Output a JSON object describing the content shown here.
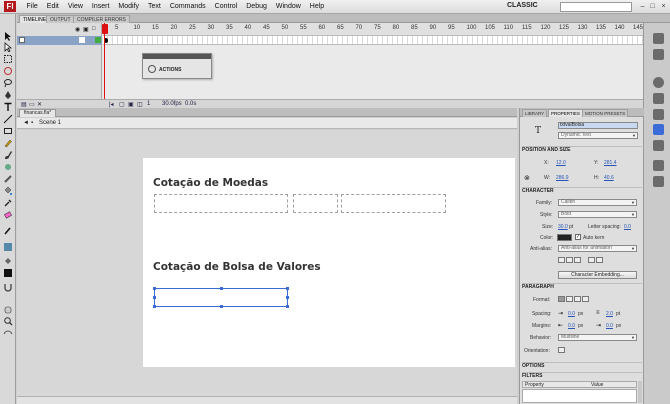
{
  "menubar": {
    "logo": "Fl",
    "items": [
      "File",
      "Edit",
      "View",
      "Insert",
      "Modify",
      "Text",
      "Commands",
      "Control",
      "Debug",
      "Window",
      "Help"
    ],
    "workspace": "CLASSIC"
  },
  "timeline": {
    "tabs": [
      "TIMELINE",
      "OUTPUT",
      "COMPILER ERRORS"
    ],
    "ruler": [
      "5",
      "10",
      "15",
      "20",
      "25",
      "30",
      "35",
      "40",
      "45",
      "50",
      "55",
      "60",
      "65",
      "70",
      "75",
      "80",
      "85",
      "90",
      "95",
      "100",
      "105",
      "110",
      "115",
      "120",
      "125",
      "130",
      "135",
      "140",
      "145"
    ],
    "status": {
      "frame": "1",
      "fps": "30.0fps",
      "time": "0.0s"
    },
    "actions_panel": "ACTIONS"
  },
  "document": {
    "tab": "financas.fla*",
    "scene": "Scene 1",
    "stage": {
      "heading1": "Cotação de Moedas",
      "heading2": "Cotação de Bolsa de Valores"
    }
  },
  "properties": {
    "tabs": [
      "LIBRARY",
      "PROPERTIES",
      "MOTION PRESETS"
    ],
    "instance_name": "txtvalBolsa",
    "text_type": "Dynamic Text",
    "position_size": {
      "title": "POSITION AND SIZE",
      "x_label": "X:",
      "x": "12.0",
      "y_label": "Y:",
      "y": "281.4",
      "w_label": "W:",
      "w": "286.9",
      "h_label": "H:",
      "h": "40.6"
    },
    "character": {
      "title": "CHARACTER",
      "family_label": "Family:",
      "family": "Calibri",
      "style_label": "Style:",
      "style": "Bold",
      "size_label": "Size:",
      "size": "30.0",
      "size_unit": "pt",
      "letter_spacing_label": "Letter spacing:",
      "letter_spacing": "0.0",
      "color_label": "Color:",
      "color": "#222222",
      "autokern": "Auto kern",
      "antialias_label": "Anti-alias:",
      "antialias": "Anti-alias for animation",
      "embed_button": "Character Embedding..."
    },
    "paragraph": {
      "title": "PARAGRAPH",
      "format_label": "Format:",
      "spacing_label": "Spacing:",
      "spacing_indent": "0.0",
      "spacing_line": "2.0",
      "margins_label": "Margins:",
      "margin_left": "0.0",
      "margin_right": "0.0",
      "px": "px",
      "pt": "pt",
      "behavior_label": "Behavior:",
      "behavior": "Multiline",
      "orientation_label": "Orientation:"
    },
    "options": {
      "title": "OPTIONS"
    },
    "filters": {
      "title": "FILTERS",
      "col_property": "Property",
      "col_value": "Value"
    }
  },
  "colors": {
    "accent": "#3a6bd6",
    "selection": "#8aa2c6",
    "playhead": "#dd1111"
  }
}
